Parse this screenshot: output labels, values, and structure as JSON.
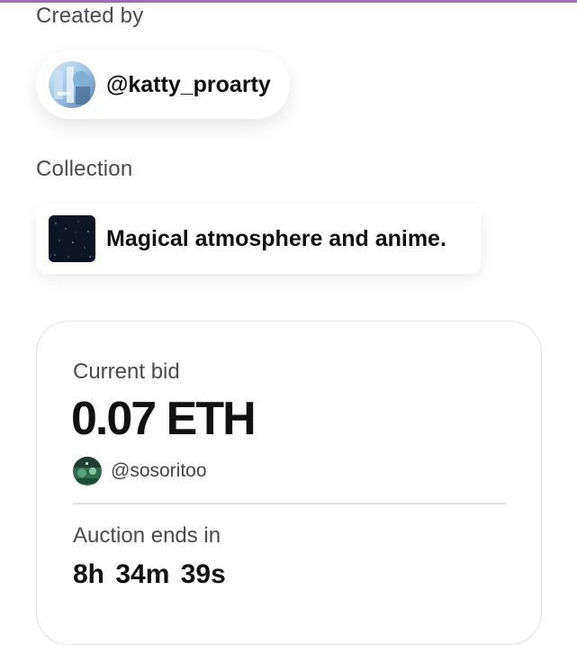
{
  "created_by": {
    "label": "Created by",
    "username": "@katty_proarty"
  },
  "collection": {
    "label": "Collection",
    "name": "Magical atmosphere and anime."
  },
  "auction": {
    "current_bid_label": "Current bid",
    "current_bid_value": "0.07 ETH",
    "bidder_username": "@sosoritoo",
    "ends_label": "Auction ends in",
    "countdown": "8h  34m  39s"
  },
  "colors": {
    "accent_top_line": "#9b6fb2",
    "text_primary": "#111111",
    "text_secondary": "#4a4a4a"
  },
  "icons": {
    "creator_avatar": "creator-avatar-anime",
    "collection_thumb": "collection-thumbnail-starfield",
    "bidder_avatar": "bidder-avatar"
  }
}
